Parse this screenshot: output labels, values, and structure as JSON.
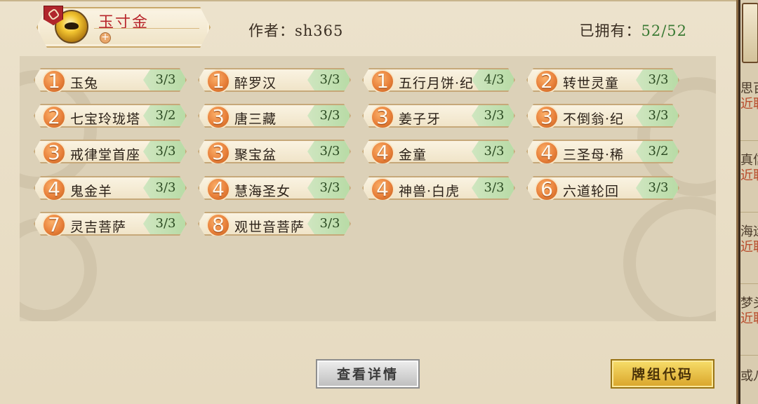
{
  "deck": {
    "name": "玉寸金",
    "add_symbol": "+"
  },
  "author_line": "作者：sh365",
  "owned": {
    "label": "已拥有：",
    "value": "52/52"
  },
  "cards": [
    {
      "cost": "1",
      "name": "玉兔",
      "count": "3/3"
    },
    {
      "cost": "1",
      "name": "醉罗汉",
      "count": "3/3"
    },
    {
      "cost": "1",
      "name": "五行月饼·纪",
      "count": "4/3"
    },
    {
      "cost": "2",
      "name": "转世灵童",
      "count": "3/3"
    },
    {
      "cost": "2",
      "name": "七宝玲珑塔",
      "count": "3/2"
    },
    {
      "cost": "3",
      "name": "唐三藏",
      "count": "3/3"
    },
    {
      "cost": "3",
      "name": "姜子牙",
      "count": "3/3"
    },
    {
      "cost": "3",
      "name": "不倒翁·纪",
      "count": "3/3"
    },
    {
      "cost": "3",
      "name": "戒律堂首座",
      "count": "3/3"
    },
    {
      "cost": "3",
      "name": "聚宝盆",
      "count": "3/3"
    },
    {
      "cost": "4",
      "name": "金童",
      "count": "3/3"
    },
    {
      "cost": "4",
      "name": "三圣母·稀",
      "count": "3/2"
    },
    {
      "cost": "4",
      "name": "鬼金羊",
      "count": "3/3"
    },
    {
      "cost": "4",
      "name": "慧海圣女",
      "count": "3/3"
    },
    {
      "cost": "4",
      "name": "神兽·白虎",
      "count": "3/3"
    },
    {
      "cost": "6",
      "name": "六道轮回",
      "count": "3/3"
    },
    {
      "cost": "7",
      "name": "灵吉菩萨",
      "count": "3/3"
    },
    {
      "cost": "8",
      "name": "观世音菩萨",
      "count": "3/3"
    }
  ],
  "buttons": {
    "detail": "查看详情",
    "deck_code": "牌组代码"
  },
  "side_list": [
    {
      "line1": "思百",
      "line2": "近联"
    },
    {
      "line1": "真信",
      "line2": "近联"
    },
    {
      "line1": "海运",
      "line2": "近联"
    },
    {
      "line1": "梦头",
      "line2": "近联"
    },
    {
      "line1": "或八",
      "line2": ""
    }
  ],
  "colors": {
    "deck_name": "#b8262c",
    "count_badge": "#b8dba6",
    "cost_orb": "#e8803a",
    "deck_code_button": "#d9a42a",
    "detail_button": "#bdbdbd"
  }
}
